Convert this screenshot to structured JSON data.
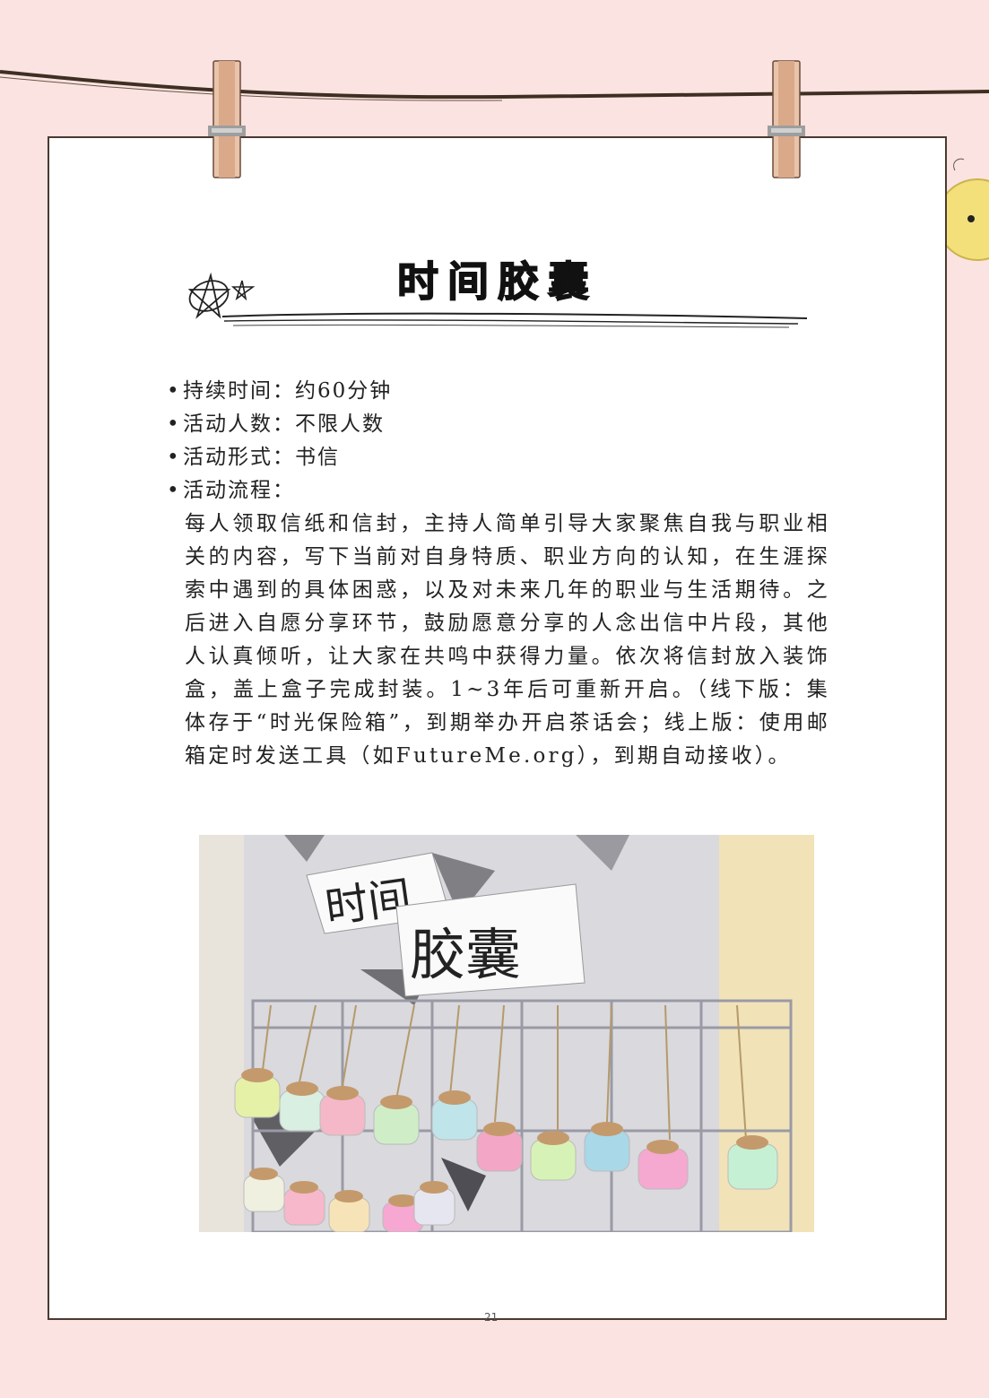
{
  "title": "时间胶囊",
  "info": {
    "duration": "持续时间：约60分钟",
    "participants": "活动人数：不限人数",
    "format": "活动形式：书信",
    "process_label": "活动流程：",
    "process_text": "每人领取信纸和信封，主持人简单引导大家聚焦自我与职业相关的内容，写下当前对自身特质、职业方向的认知，在生涯探索中遇到的具体困惑，以及对未来几年的职业与生活期待。之后进入自愿分享环节，鼓励愿意分享的人念出信中片段，其他人认真倾听，让大家在共鸣中获得力量。依次将信封放入装饰盒，盖上盒子完成封装。1~3年后可重新开启。（线下版：集体存于“时光保险箱”，到期举办开启茶话会；线上版：使用邮箱定时发送工具（如FutureMe.org），到期自动接收）。",
    "bullet": "•"
  },
  "photo": {
    "sign_line1": "时间",
    "sign_line2": "胶囊"
  },
  "page_number": "21",
  "colors": {
    "background": "#fbe3e1",
    "card": "#ffffff",
    "border": "#4a3a30",
    "rope": "#3e2f22",
    "clothespin": "#d9a98a"
  }
}
